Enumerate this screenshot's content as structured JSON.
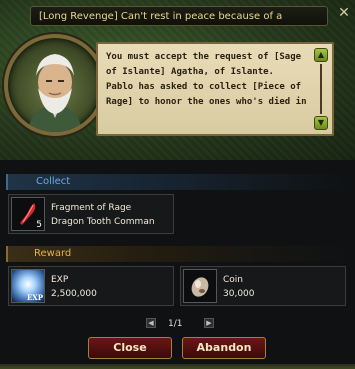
{
  "window": {
    "title": "[Long Revenge] Can't rest in peace because of a",
    "close_glyph": "✕"
  },
  "dialog": {
    "lines": [
      "You must accept the request of [Sage",
      "of Islante] Agatha, of Islante.",
      "Pablo has asked to collect [Piece of",
      "Rage] to honor the ones who's died in"
    ],
    "scroll_up": "▲",
    "scroll_down": "▼"
  },
  "collect": {
    "label": "Collect",
    "items": [
      {
        "name": "Fragment of Rage",
        "source": "Dragon Tooth Comman",
        "count": "5",
        "icon": "red-feather-icon"
      }
    ]
  },
  "reward": {
    "label": "Reward",
    "items": [
      {
        "name": "EXP",
        "value": "2,500,000",
        "icon_label": "EXP",
        "icon": "exp-orb-icon"
      },
      {
        "name": "Coin",
        "value": "30,000",
        "icon": "coin-pouch-icon"
      }
    ]
  },
  "pager": {
    "text": "1/1",
    "prev": "◀",
    "next": "▶"
  },
  "buttons": {
    "close": "Close",
    "abandon": "Abandon"
  },
  "colors": {
    "collect_label": "#6aa9e8",
    "reward_label": "#e5b24a",
    "button_bg": "#5a1212"
  }
}
